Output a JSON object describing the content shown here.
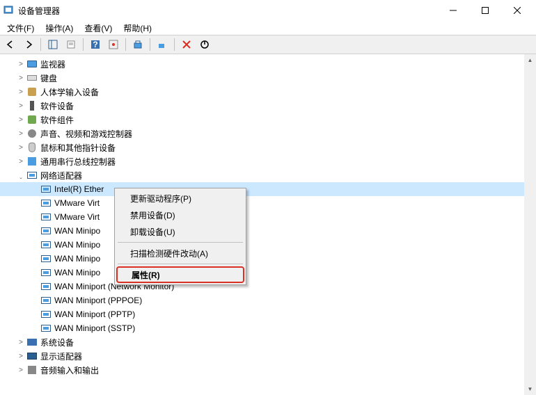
{
  "titlebar": {
    "title": "设备管理器"
  },
  "menubar": {
    "file": "文件(F)",
    "action": "操作(A)",
    "view": "查看(V)",
    "help": "帮助(H)"
  },
  "tree": {
    "nodes": [
      {
        "label": "监视器",
        "icon": "monitor",
        "expanded": false
      },
      {
        "label": "键盘",
        "icon": "keyboard",
        "expanded": false
      },
      {
        "label": "人体学输入设备",
        "icon": "hid",
        "expanded": false
      },
      {
        "label": "软件设备",
        "icon": "soft",
        "expanded": false
      },
      {
        "label": "软件组件",
        "icon": "puzzle",
        "expanded": false
      },
      {
        "label": "声音、视频和游戏控制器",
        "icon": "sound",
        "expanded": false
      },
      {
        "label": "鼠标和其他指针设备",
        "icon": "mouse",
        "expanded": false
      },
      {
        "label": "通用串行总线控制器",
        "icon": "usb",
        "expanded": false
      },
      {
        "label": "网络适配器",
        "icon": "net",
        "expanded": true,
        "children": [
          {
            "label": "Intel(R) Ether",
            "icon": "net",
            "selected": true
          },
          {
            "label": "VMware Virt",
            "icon": "net"
          },
          {
            "label": "VMware Virt",
            "icon": "net"
          },
          {
            "label": "WAN Minipo",
            "icon": "net"
          },
          {
            "label": "WAN Minipo",
            "icon": "net"
          },
          {
            "label": "WAN Minipo",
            "icon": "net"
          },
          {
            "label": "WAN Minipo",
            "icon": "net"
          },
          {
            "label": "WAN Miniport (Network Monitor)",
            "icon": "net"
          },
          {
            "label": "WAN Miniport (PPPOE)",
            "icon": "net"
          },
          {
            "label": "WAN Miniport (PPTP)",
            "icon": "net"
          },
          {
            "label": "WAN Miniport (SSTP)",
            "icon": "net"
          }
        ]
      },
      {
        "label": "系统设备",
        "icon": "sys",
        "expanded": false
      },
      {
        "label": "显示适配器",
        "icon": "display",
        "expanded": false
      },
      {
        "label": "音频输入和输出",
        "icon": "audio",
        "expanded": false
      }
    ]
  },
  "context_menu": {
    "items": [
      {
        "label": "更新驱动程序(P)"
      },
      {
        "label": "禁用设备(D)"
      },
      {
        "label": "卸载设备(U)"
      },
      {
        "sep": true
      },
      {
        "label": "扫描检测硬件改动(A)"
      },
      {
        "sep": true
      },
      {
        "label": "属性(R)",
        "highlighted": true
      }
    ]
  }
}
